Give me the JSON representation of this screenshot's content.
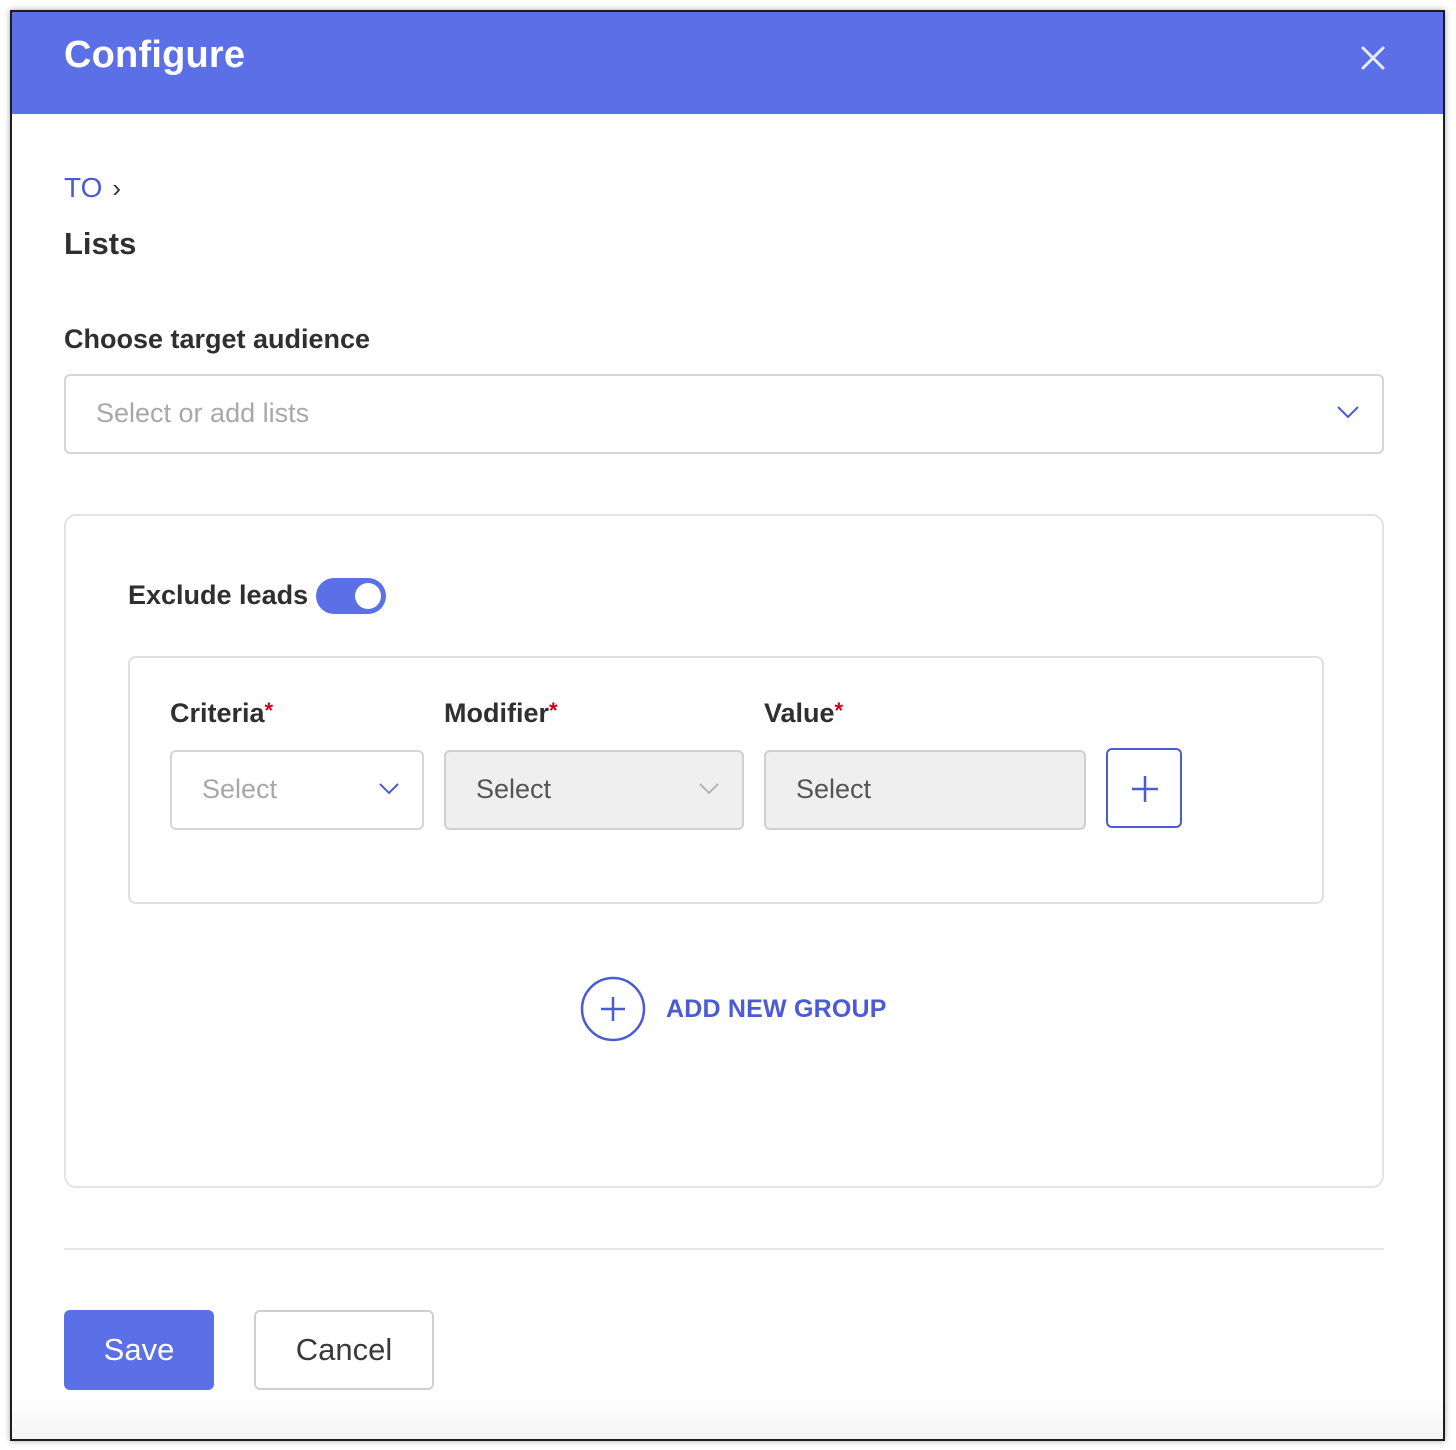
{
  "dialog": {
    "title": "Configure",
    "close_icon": "close-icon",
    "accent_color": "#5b6fe6"
  },
  "breadcrumb": {
    "root": "TO",
    "separator": "›"
  },
  "page_title": "Lists",
  "audience": {
    "label": "Choose target audience",
    "placeholder": "Select or add lists",
    "icon": "chevron-down-icon"
  },
  "exclude": {
    "label": "Exclude leads",
    "enabled": true
  },
  "criteria_group": {
    "criteria": {
      "label": "Criteria",
      "required_mark": "*",
      "placeholder": "Select"
    },
    "modifier": {
      "label": "Modifier",
      "required_mark": "*",
      "placeholder": "Select"
    },
    "value": {
      "label": "Value",
      "required_mark": "*",
      "placeholder": "Select"
    },
    "add_icon": "plus-icon"
  },
  "add_group": {
    "label": "ADD NEW GROUP",
    "icon": "plus-circle-icon"
  },
  "footer": {
    "save_label": "Save",
    "cancel_label": "Cancel"
  }
}
